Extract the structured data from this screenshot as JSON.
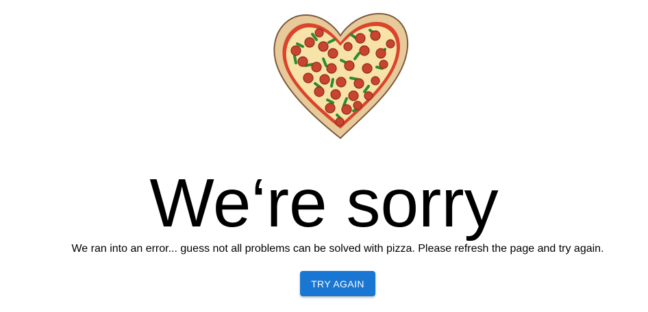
{
  "error_page": {
    "image_name": "heart-shaped-pizza-illustration",
    "title": "We‘re sorry",
    "message": "We ran into an error... guess not all problems can be solved with pizza. Please refresh the page and try again.",
    "button_label": "TRY AGAIN"
  },
  "colors": {
    "button_bg": "#1976d2",
    "button_text": "#ffffff",
    "text": "#000000",
    "crust": "#e7c99a",
    "cheese": "#f7e3a8",
    "sauce": "#d9442b",
    "pepperoni": "#c7452f",
    "pepper": "#2f8a2f"
  }
}
